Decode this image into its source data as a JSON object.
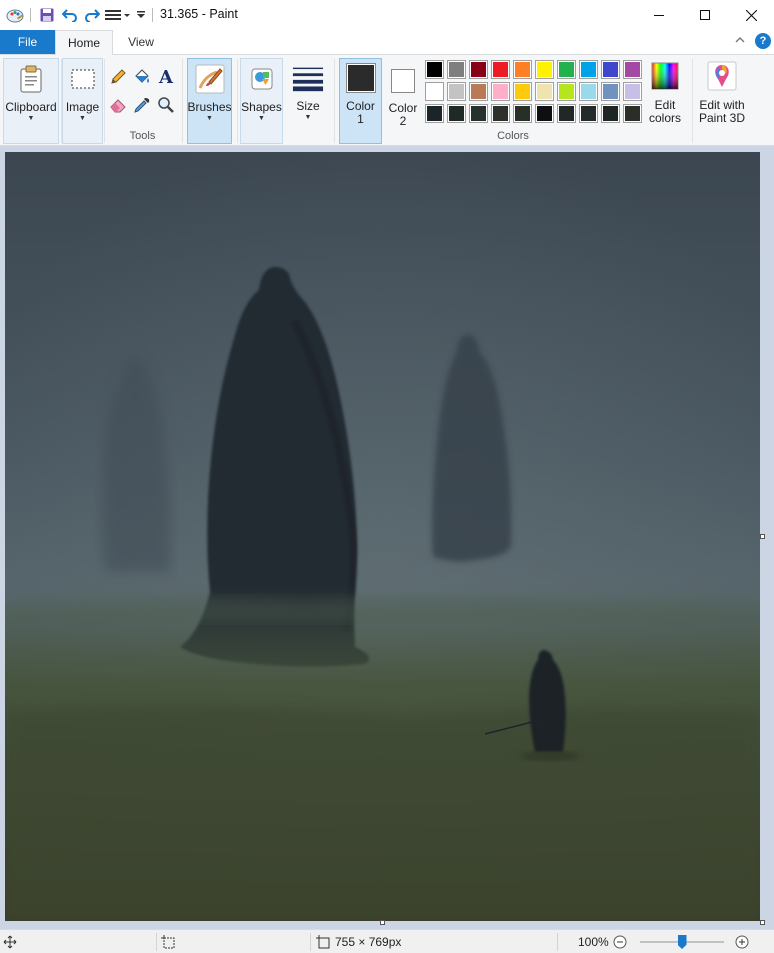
{
  "window": {
    "title": "31.365 - Paint",
    "controls": [
      "minimize-icon",
      "maximize-icon",
      "close-icon"
    ]
  },
  "quick_access": [
    "paint-app-icon",
    "save-icon",
    "undo-icon",
    "redo-icon",
    "customize-icon",
    "dropdown-icon"
  ],
  "tabs": {
    "file": "File",
    "home": "Home",
    "view": "View",
    "active": "Home"
  },
  "ribbon": {
    "clipboard": {
      "label": "Clipboard"
    },
    "image": {
      "label": "Image"
    },
    "tools": {
      "label": "Tools",
      "items": [
        "pencil-icon",
        "fill-icon",
        "text-icon",
        "eraser-icon",
        "color-picker-icon",
        "magnifier-icon"
      ]
    },
    "brushes": {
      "label": "Brushes"
    },
    "shapes": {
      "label": "Shapes"
    },
    "size": {
      "label": "Size"
    },
    "color1": {
      "label1": "Color",
      "label2": "1",
      "color": "#2b2b2b"
    },
    "color2": {
      "label1": "Color",
      "label2": "2",
      "color": "#ffffff"
    },
    "colors": {
      "label": "Colors",
      "palette_row1": [
        "#000000",
        "#7f7f7f",
        "#880015",
        "#ed1c24",
        "#ff7f27",
        "#fff200",
        "#22b14c",
        "#00a2e8",
        "#3f48cc",
        "#a349a4"
      ],
      "palette_row2": [
        "#ffffff",
        "#c3c3c3",
        "#b97a57",
        "#ffaec9",
        "#ffc90e",
        "#efe4b0",
        "#b5e61d",
        "#99d9ea",
        "#7092be",
        "#c8bfe7"
      ],
      "palette_row3": [
        "#1b2428",
        "#1f2a26",
        "#27302c",
        "#2c312c",
        "#263028",
        "#0d1010",
        "#202726",
        "#242a29",
        "#1f2523",
        "#2b2d27"
      ]
    },
    "edit_colors": {
      "line1": "Edit",
      "line2": "colors"
    },
    "paint3d": {
      "line1": "Edit with",
      "line2": "Paint 3D"
    }
  },
  "status": {
    "image_size": "755 × 769px",
    "zoom": "100%",
    "zoom_fraction": 0.5
  }
}
